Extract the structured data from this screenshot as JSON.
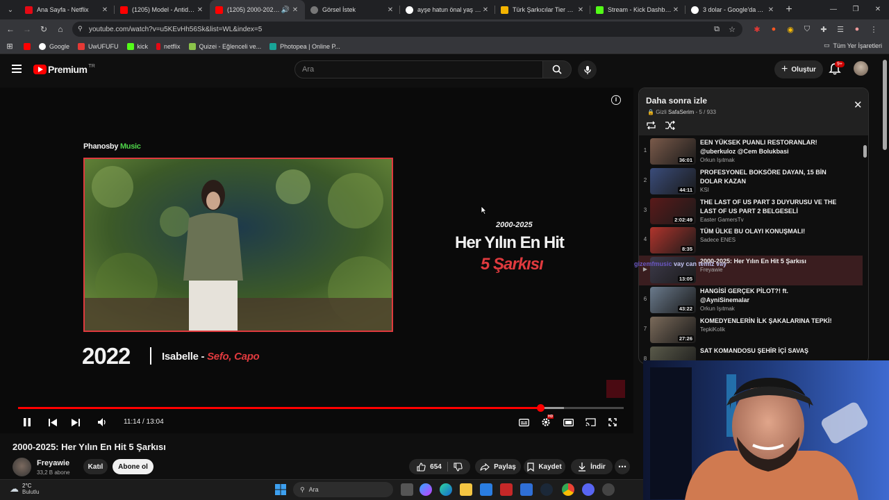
{
  "browser": {
    "tabs": [
      {
        "title": "Ana Sayfa - Netflix",
        "fav": "#e50914"
      },
      {
        "title": "(1205) Model - Antidepre",
        "fav": "#ff0000"
      },
      {
        "title": "(1205) 2000-2025: He",
        "fav": "#ff0000",
        "active": true
      },
      {
        "title": "Görsel İstek",
        "fav": "#cccccc"
      },
      {
        "title": "ayşe hatun önal yaş - Goo",
        "fav": "#4285f4"
      },
      {
        "title": "Türk Şarkıcılar Tier List (C",
        "fav": "#f4b400"
      },
      {
        "title": "Stream - Kick Dashboard",
        "fav": "#53fc18"
      },
      {
        "title": "3 dolar - Google'da Ara",
        "fav": "#4285f4"
      }
    ],
    "new_tab": "+",
    "url": "youtube.com/watch?v=u5KEvHh56Sk&list=WL&index=5",
    "bookmarks": [
      {
        "label": "",
        "fav": "#ff0000"
      },
      {
        "label": "Google",
        "fav": "#4285f4"
      },
      {
        "label": "UwUFUFU",
        "fav": "#e53935"
      },
      {
        "label": "kick",
        "fav": "#53fc18"
      },
      {
        "label": "netflix",
        "fav": "#e50914"
      },
      {
        "label": "Quizei - Eğlenceli ve...",
        "fav": "#8bc34a"
      },
      {
        "label": "Photopea | Online P...",
        "fav": "#18a497"
      }
    ],
    "all_bookmarks": "Tüm Yer İşaretleri"
  },
  "header": {
    "logo_text": "Premium",
    "logo_region": "TR",
    "search_placeholder": "Ara",
    "create_label": "Oluştur",
    "notif_count": "9+"
  },
  "player": {
    "brand_a": "Phanosby ",
    "brand_b": "Music",
    "year": "2022",
    "song_title": "Isabelle - ",
    "song_artists": "Sefo, Capo",
    "hero_sub": "2000-2025",
    "hero_main": "Her Yılın En Hit",
    "hero_red": "5 Şarkısı",
    "time": "11:14 / 13:04",
    "progress": 0.862,
    "buffered": 0.901,
    "settings_badge": "HD"
  },
  "video": {
    "title": "2000-2025: Her Yılın En Hit 5 Şarkısı",
    "channel": "Freyawie",
    "subs": "33,2 B abone",
    "join": "Katıl",
    "subscribe": "Abone ol",
    "likes": "654",
    "share": "Paylaş",
    "save": "Kaydet",
    "download": "İndir"
  },
  "playlist": {
    "title": "Daha sonra izle",
    "privacy": "Gizli",
    "owner": "SafaSerim",
    "position": "- 5 / 933",
    "items": [
      {
        "idx": "1",
        "title": "EEN YÜKSEK PUANLI RESTORANLAR! @uberkuloz @Cem Bolukbasi",
        "channel": "Orkun Işıtmak",
        "dur": "36:01",
        "thumb": "#7a5a4a"
      },
      {
        "idx": "2",
        "title": "PROFESYONEL BOKSÖRE DAYAN, 15 BİN DOLAR KAZAN",
        "channel": "KSI",
        "dur": "44:11",
        "thumb": "#3a4c7a"
      },
      {
        "idx": "3",
        "title": "THE LAST OF US PART 3 DUYURUSU VE THE LAST OF US PART 2 BELGESELİ",
        "channel": "Easter GamersTv",
        "dur": "2:02:49",
        "thumb": "#5a1a1a"
      },
      {
        "idx": "4",
        "title": "TÜM ÜLKE BU OLAYI KONUŞMALI!",
        "channel": "Sadece ENES",
        "dur": "8:35",
        "thumb": "#b0342c"
      },
      {
        "idx": "▶",
        "title": "2000-2025: Her Yılın En Hit 5 Şarkısı",
        "channel": "Freyawie",
        "dur": "13:05",
        "thumb": "#3d3a4a",
        "current": true
      },
      {
        "idx": "6",
        "title": "HANGİSİ GERÇEK PİLOT?! ft. @AyniSinemalar",
        "channel": "Orkun Işıtmak",
        "dur": "43:22",
        "thumb": "#6a7a8c"
      },
      {
        "idx": "7",
        "title": "KOMEDYENLERİN İLK ŞAKALARINA TEPKİ!",
        "channel": "TepkiKolik",
        "dur": "27:26",
        "thumb": "#7a6a5a"
      },
      {
        "idx": "8",
        "title": "SAT KOMANDOSU ŞEHİR İÇİ SAVAŞ",
        "channel": "",
        "dur": "",
        "thumb": "#5a5a4a"
      }
    ]
  },
  "chat": {
    "user": "gizemfmusic",
    "message": "vay can temiz vay"
  },
  "taskbar": {
    "temp": "2°C",
    "weather": "Bulutlu",
    "search": "Ara"
  }
}
